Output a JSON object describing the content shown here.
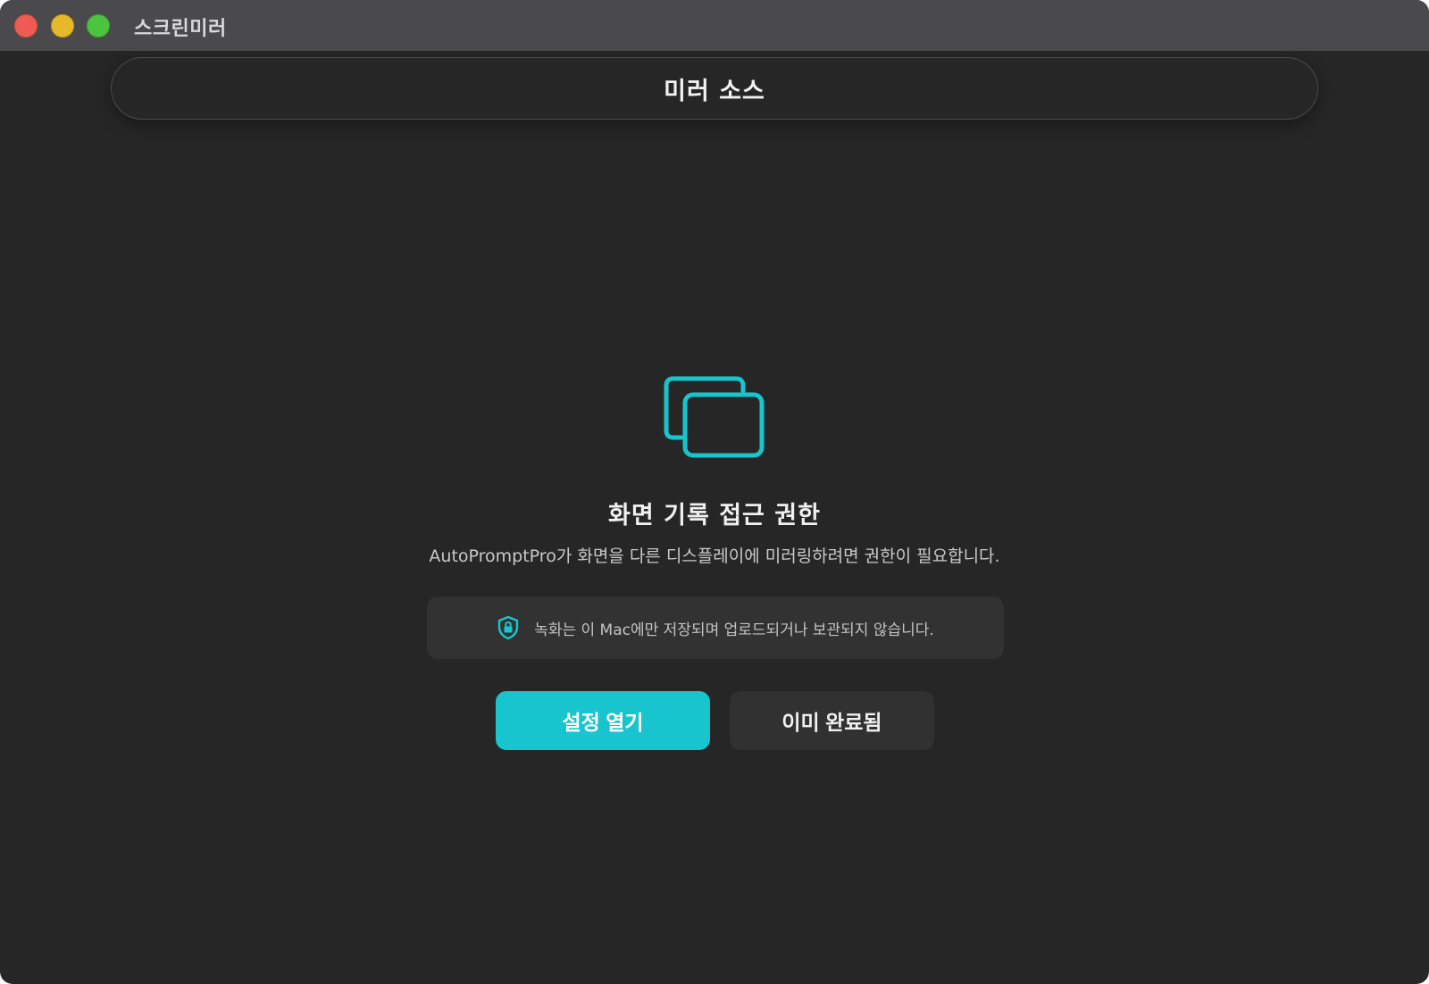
{
  "window": {
    "title": "스크린미러",
    "controls": {
      "close": "close-button",
      "minimize": "minimize-button",
      "zoom": "zoom-button"
    }
  },
  "source_header": {
    "label": "미러 소스"
  },
  "permission": {
    "icon": "screens-icon",
    "title": "화면 기록 접근 권한",
    "description": "AutoPromptPro가 화면을 다른 디스플레이에 미러링하려면 권한이 필요합니다.",
    "notice": {
      "icon": "shield-lock-icon",
      "text": "녹화는 이 Mac에만 저장되며 업로드되거나 보관되지 않습니다."
    }
  },
  "actions": {
    "open_settings": "설정 열기",
    "already_done": "이미 완료됨"
  },
  "colors": {
    "accent": "#18c5cf",
    "background": "#262626",
    "titlebar": "#4a4a4c"
  }
}
